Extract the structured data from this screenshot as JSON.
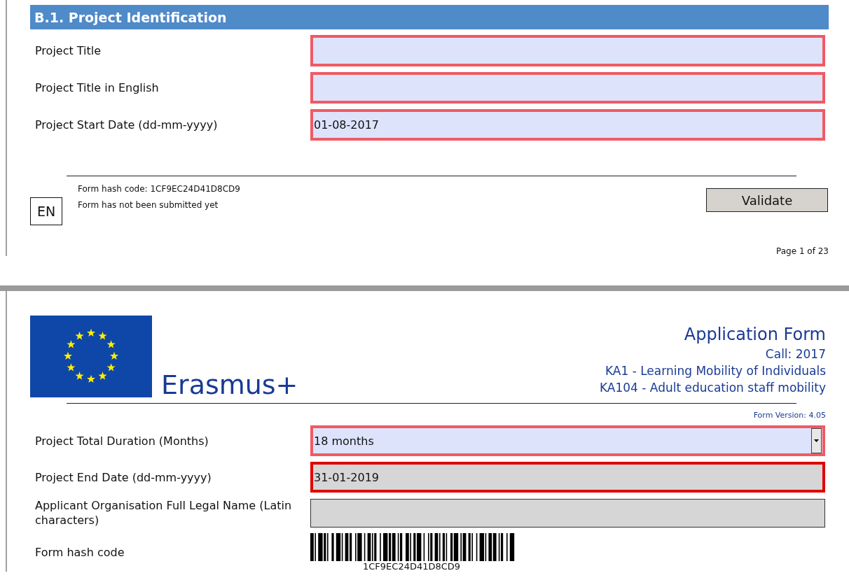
{
  "page1": {
    "section_title": "B.1. Project Identification",
    "fields": [
      {
        "label": "Project Title",
        "kind": "text",
        "error": true,
        "readonly": false
      },
      {
        "label": "Project Title in English",
        "kind": "text",
        "error": true,
        "readonly": false
      },
      {
        "label": "Project Start Date (dd-mm-yyyy)",
        "kind": "text",
        "value": "01-08-2017",
        "error": true,
        "readonly": false
      }
    ],
    "footer": {
      "language": "EN",
      "hash_line": "Form hash code: 1CF9EC24D41D8CD9",
      "status": "Form has not been submitted yet",
      "validate_button": "Validate",
      "page_number": "Page 1 of 23"
    }
  },
  "page2": {
    "brand": "Erasmus+",
    "title": "Application Form",
    "call": "Call: 2017",
    "action": "KA1 - Learning Mobility of Individuals",
    "subaction": "KA104 - Adult education staff mobility",
    "form_version": "Form Version: 4.05",
    "fields": [
      {
        "label": "Project Total Duration (Months)",
        "kind": "select",
        "value": "18 months",
        "error": true,
        "readonly": false
      },
      {
        "label": "Project End Date (dd-mm-yyyy)",
        "kind": "text",
        "value": "31-01-2019",
        "error": true,
        "readonly": true
      },
      {
        "label": "Applicant Organisation Full Legal Name (Latin characters)",
        "kind": "text",
        "error": false,
        "readonly": true
      }
    ],
    "hash_row": {
      "label": "Form hash code",
      "code": "1CF9EC24D41D8CD9"
    }
  }
}
